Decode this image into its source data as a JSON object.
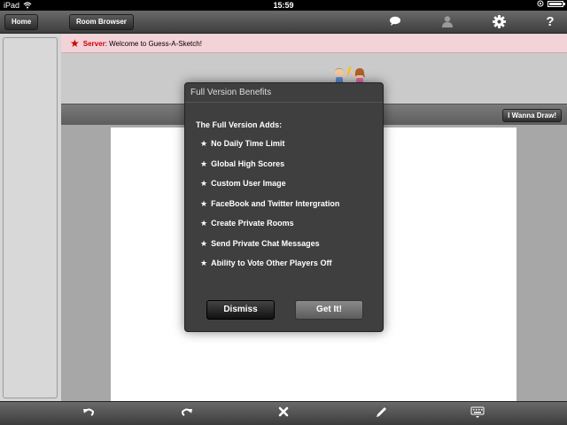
{
  "status_bar": {
    "device": "iPad",
    "time": "15:59"
  },
  "toolbar": {
    "home_label": "Home",
    "room_browser_label": "Room Browser",
    "icons": [
      "chat-icon",
      "user-icon",
      "gear-icon",
      "help-icon"
    ],
    "help_glyph": "?"
  },
  "chat": {
    "messages": [
      {
        "sender": "Server",
        "separator": ":",
        "text": " Welcome to Guess-A-Sketch!"
      }
    ]
  },
  "canvas_header": {
    "wanna_draw_label": "I Wanna Draw!"
  },
  "modal": {
    "title": "Full Version Benefits",
    "heading": "The Full Version Adds:",
    "star_glyph": "★",
    "benefits": [
      "No Daily Time Limit",
      "Global High Scores",
      "Custom User Image",
      "FaceBook and Twitter Intergration",
      "Create Private Rooms",
      "Send Private Chat Messages",
      "Ability to Vote Other Players Off"
    ],
    "dismiss_label": "Dismiss",
    "get_it_label": "Get It!"
  },
  "bottom_toolbar": {
    "icons": [
      "undo-icon",
      "redo-icon",
      "clear-icon",
      "pencil-icon",
      "keyboard-icon"
    ]
  },
  "colors": {
    "server_name": "#cc0000",
    "chat_background": "#f3d2d8",
    "modal_background": "#3f3f3f"
  }
}
